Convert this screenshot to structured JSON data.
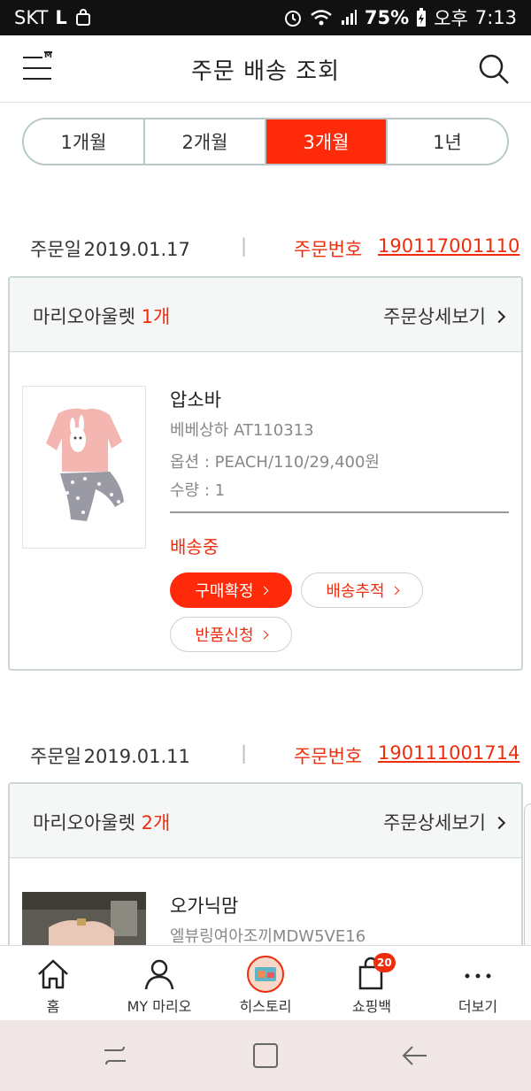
{
  "status_bar": {
    "carrier": "SKT",
    "carrier_extra": "L",
    "battery": "75%",
    "ampm": "오후",
    "time": "7:13"
  },
  "header": {
    "title": "주문 배송 조회",
    "menu_logo_letter": "M"
  },
  "period_tabs": [
    {
      "label": "1개월",
      "active": false
    },
    {
      "label": "2개월",
      "active": false
    },
    {
      "label": "3개월",
      "active": true
    },
    {
      "label": "1년",
      "active": false
    }
  ],
  "orders": [
    {
      "date_label": "주문일",
      "date": "2019.01.17",
      "separator": "|",
      "order_no_label": "주문번호",
      "order_no": "190117001110",
      "seller": "마리오아울렛",
      "count": "1개",
      "detail_label": "주문상세보기",
      "item": {
        "name": "압소바",
        "product": "베베상하 AT110313",
        "option": "옵션 : PEACH/110/29,400원",
        "qty": "수량 : 1",
        "status": "배송중",
        "buttons": {
          "confirm": "구매확정",
          "track": "배송추적",
          "return": "반품신청"
        }
      }
    },
    {
      "date_label": "주문일",
      "date": "2019.01.11",
      "separator": "|",
      "order_no_label": "주문번호",
      "order_no": "190111001714",
      "seller": "마리오아울렛",
      "count": "2개",
      "detail_label": "주문상세보기",
      "item": {
        "name": "오가닉맘",
        "product": "엘뷰링여아조끼MDW5VE16"
      }
    }
  ],
  "bottom_nav": [
    {
      "label": "홈",
      "icon": "home-icon"
    },
    {
      "label": "MY 마리오",
      "icon": "person-icon"
    },
    {
      "label": "히스토리",
      "icon": "history-thumb-icon"
    },
    {
      "label": "쇼핑백",
      "icon": "shopping-bag-icon",
      "badge": "20"
    },
    {
      "label": "더보기",
      "icon": "more-dots-icon"
    }
  ],
  "colors": {
    "accent": "#ff2a0a",
    "accent_text": "#ee2d0d",
    "border": "#ccd6d6"
  }
}
